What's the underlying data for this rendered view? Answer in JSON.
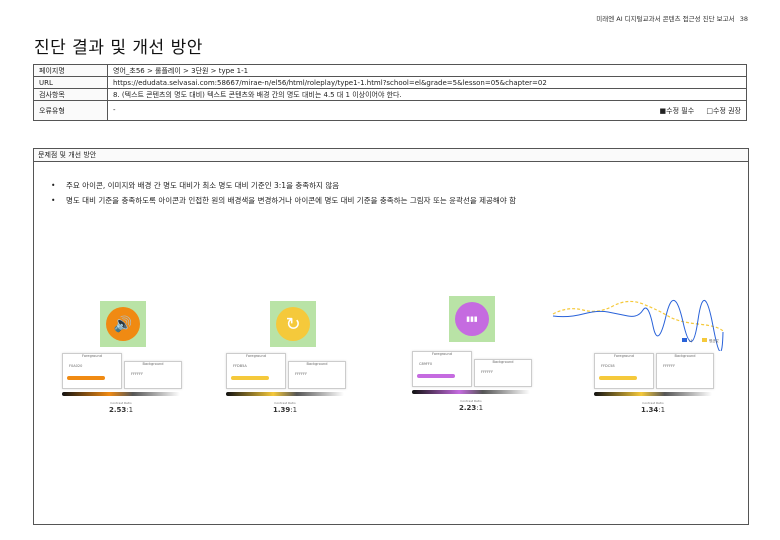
{
  "header": {
    "report_title": "미래엔 AI 디지털교과서 콘텐츠 접근성 진단 보고서",
    "page_number": "38"
  },
  "title": "진단 결과 및 개선 방안",
  "info": {
    "page_name_label": "페이지명",
    "page_name": "영어_초56 > 롤플레이 > 3단원 > type 1-1",
    "url_label": "URL",
    "url": "https://edudata.selvasai.com:58667/mirae-n/el56/html/roleplay/type1-1.html?school=el&grade=5&lesson=05&chapter=02",
    "check_label": "검사항목",
    "check": "8. (텍스트 콘텐츠의 명도 대비) 텍스트 콘텐츠와 배경 간의 명도 대비는 4.5 대 1 이상이어야 한다.",
    "error_label": "오류유형",
    "error": "-",
    "option_required": "■수정 필수",
    "option_recommended": "□수정 권장"
  },
  "issue": {
    "heading": "문제점 및 개선 방안",
    "bullets": [
      "주요 아이콘, 이미지와 배경 간 명도 대비가 최소 명도 대비 기준인 3:1을 충족하지 않음",
      "명도 대비 기준을 충족하도록 아이콘과 인접한 원의 배경색을 변경하거나 아이콘에 명도 대비 기준을 충족하는 그림자 또는 윤곽선을 제공해야 함"
    ]
  },
  "icons": [
    {
      "name": "speaker-icon",
      "glyph": "🔊",
      "color": "#f08a12"
    },
    {
      "name": "replay-icon",
      "glyph": "↻",
      "color": "#f5c93b"
    },
    {
      "name": "chart-icon",
      "glyph": "▮▮▮",
      "color": "#c56be0"
    }
  ],
  "contrast_panels": [
    {
      "fg_label": "Foreground",
      "bg_label": "Background",
      "fg_hex": "F0A020",
      "bg_hex": "FFFFFF",
      "bar_color": "#f08a12",
      "ratio_bold": "2.53",
      "ratio_rest": ":1",
      "contrast_label": "Contrast Ratio"
    },
    {
      "fg_label": "Foreground",
      "bg_label": "Background",
      "fg_hex": "FFDB5A",
      "bg_hex": "FFFFFF",
      "bar_color": "#f5c93b",
      "ratio_bold": "1.39",
      "ratio_rest": ":1",
      "contrast_label": "Contrast Ratio"
    },
    {
      "fg_label": "Foreground",
      "bg_label": "Background",
      "fg_hex": "C89FF0",
      "bg_hex": "FFFFFF",
      "bar_color": "#c56be0",
      "ratio_bold": "2.23",
      "ratio_rest": ":1",
      "contrast_label": "Contrast Ratio"
    },
    {
      "fg_label": "Foreground",
      "bg_label": "Background",
      "fg_hex": "FFDC58",
      "bg_hex": "FFFFFF",
      "bar_color": "#f5c93b",
      "ratio_bold": "1.34",
      "ratio_rest": ":1",
      "contrast_label": "Contrast Ratio"
    }
  ],
  "legend": {
    "series_a": "나",
    "series_b": "평균값",
    "color_a": "#2962d9",
    "color_b": "#f5c93b"
  }
}
